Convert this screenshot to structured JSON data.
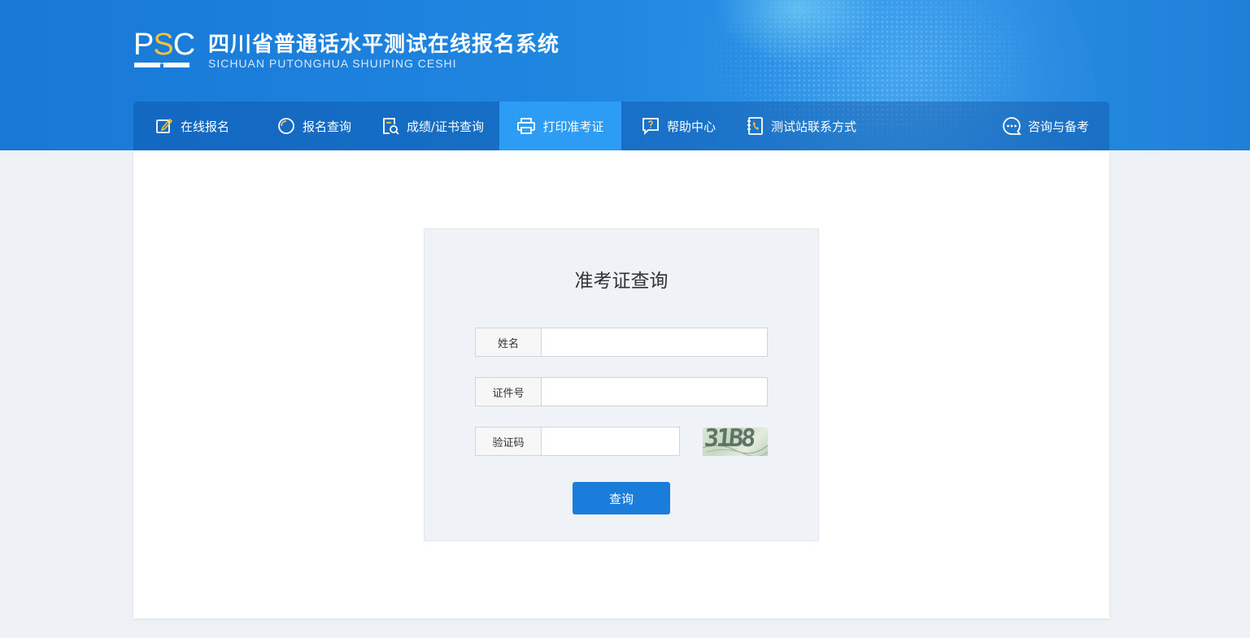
{
  "header": {
    "logo_text_p": "P",
    "logo_text_s": "S",
    "logo_text_c": "C",
    "title": "四川省普通话水平测试在线报名系统",
    "subtitle": "SICHUAN PUTONGHUA SHUIPING CESHI"
  },
  "nav": {
    "items": [
      {
        "label": "在线报名",
        "icon": "edit-icon"
      },
      {
        "label": "报名查询",
        "icon": "search-circle-icon"
      },
      {
        "label": "成绩/证书查询",
        "icon": "document-search-icon"
      },
      {
        "label": "打印准考证",
        "icon": "printer-icon",
        "active": true
      },
      {
        "label": "帮助中心",
        "icon": "help-icon"
      },
      {
        "label": "测试站联系方式",
        "icon": "phone-book-icon"
      },
      {
        "label": "咨询与备考",
        "icon": "chat-icon"
      }
    ]
  },
  "form": {
    "title": "准考证查询",
    "name_label": "姓名",
    "name_value": "",
    "id_label": "证件号",
    "id_value": "",
    "captcha_label": "验证码",
    "captcha_value": "",
    "captcha_image_text": "31B8",
    "submit_label": "查询"
  },
  "colors": {
    "primary": "#1a7ddb",
    "nav_active": "#2d9cf4",
    "logo_accent": "#f5c33b"
  }
}
